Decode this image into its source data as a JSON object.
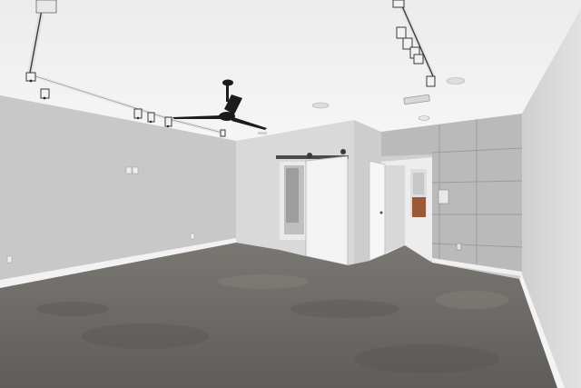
{
  "scene": {
    "description_free": true,
    "colors": {
      "ceiling": "#f1f1f1",
      "left_wall": "#c9c9c9",
      "back_wall": "#dadada",
      "right_wall": "#d6d6d6",
      "concrete_panel": "#b9b9b9",
      "floor": "#6e6c69",
      "baseboard": "#f4f4f4",
      "barn_door": "#f3f3f3",
      "fan": "#1c1c1c",
      "track": "#e6e6e6",
      "brick": "#9a5a3a"
    },
    "icons": [
      "ceiling-fan-icon",
      "track-light-icon",
      "barn-door-icon",
      "hvac-vent-icon"
    ]
  }
}
